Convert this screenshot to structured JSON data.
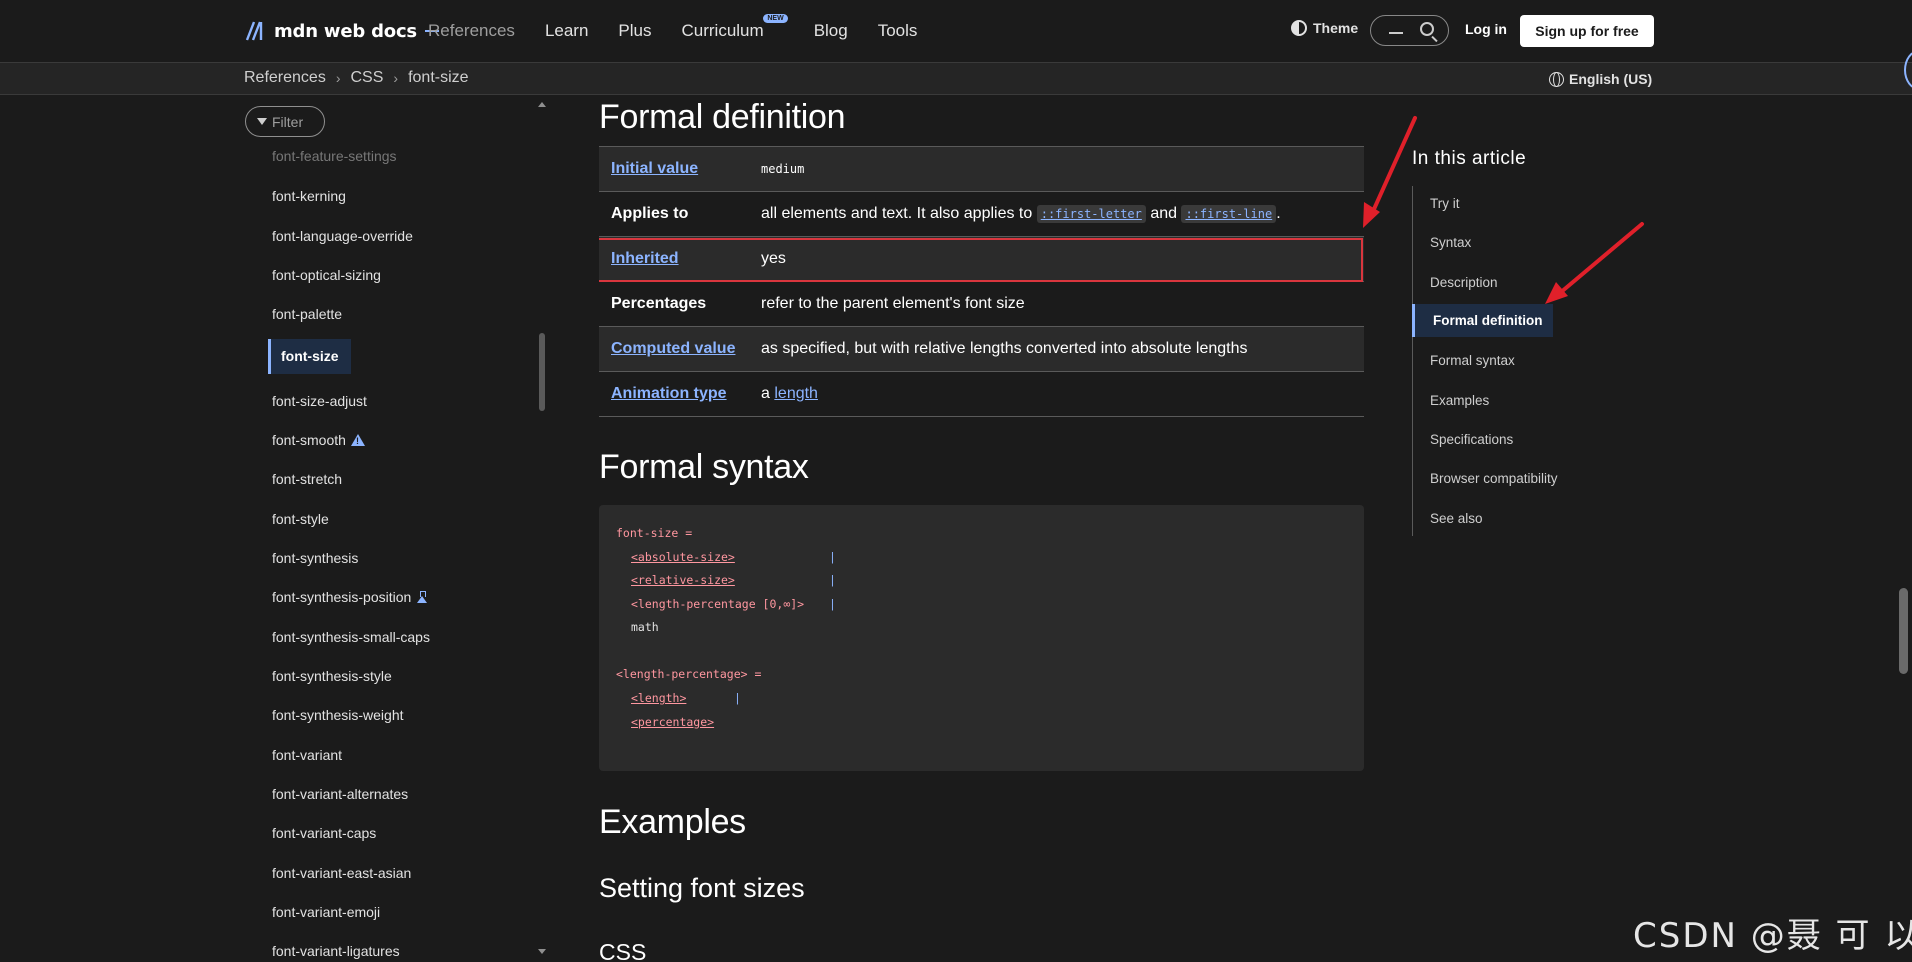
{
  "nav": {
    "logo_text": "mdn web docs",
    "links": [
      "References",
      "Learn",
      "Plus",
      "Curriculum",
      "Blog",
      "Tools"
    ],
    "new_badge": "NEW",
    "theme_label": "Theme",
    "login_label": "Log in",
    "signup_label": "Sign up for free"
  },
  "breadcrumb": {
    "items": [
      "References",
      "CSS",
      "font-size"
    ],
    "language": "English (US)"
  },
  "sidebar": {
    "filter_placeholder": "Filter",
    "items": [
      "font-feature-settings",
      "font-kerning",
      "font-language-override",
      "font-optical-sizing",
      "font-palette",
      "font-size",
      "font-size-adjust",
      "font-smooth",
      "font-stretch",
      "font-style",
      "font-synthesis",
      "font-synthesis-position",
      "font-synthesis-small-caps",
      "font-synthesis-style",
      "font-synthesis-weight",
      "font-variant",
      "font-variant-alternates",
      "font-variant-caps",
      "font-variant-east-asian",
      "font-variant-emoji",
      "font-variant-ligatures"
    ],
    "active_item": "font-size"
  },
  "main": {
    "formal_definition_title": "Formal definition",
    "definition": {
      "initial_value_label": "Initial value",
      "initial_value": "medium",
      "applies_to_label": "Applies to",
      "applies_to_text": "all elements and text. It also applies to",
      "applies_code_1": "::first-letter",
      "applies_and": "and",
      "applies_code_2": "::first-line",
      "applies_period": ".",
      "inherited_label": "Inherited",
      "inherited_value": "yes",
      "percentages_label": "Percentages",
      "percentages_value": "refer to the parent element's font size",
      "computed_label": "Computed value",
      "computed_value": "as specified, but with relative lengths converted into absolute lengths",
      "animation_label": "Animation type",
      "animation_prefix": "a",
      "animation_link": "length"
    },
    "formal_syntax_title": "Formal syntax",
    "syntax": {
      "l1": "font-size =",
      "l2": "<absolute-size>",
      "l3": "<relative-size>",
      "l4": "<length-percentage [0,∞]>",
      "l5": "math",
      "l6": "<length-percentage> =",
      "l7": "<length>",
      "l8": "<percentage>",
      "bar": "|"
    },
    "examples_title": "Examples",
    "setting_title": "Setting font sizes",
    "css_title": "CSS"
  },
  "toc": {
    "title": "In this article",
    "items": [
      "Try it",
      "Syntax",
      "Description",
      "Formal definition",
      "Formal syntax",
      "Examples",
      "Specifications",
      "Browser compatibility",
      "See also"
    ],
    "active": "Formal definition"
  },
  "watermark": "CSDN @聂 可 以",
  "colors": {
    "accent": "#8cb4ff",
    "highlight_border": "#d9363e",
    "arrow": "#e0202a"
  }
}
